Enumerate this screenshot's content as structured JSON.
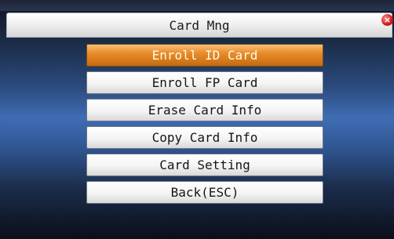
{
  "window": {
    "title": "Card Mng"
  },
  "menu": {
    "items": [
      {
        "label": "Enroll ID Card",
        "selected": true
      },
      {
        "label": "Enroll FP Card",
        "selected": false
      },
      {
        "label": "Erase Card Info",
        "selected": false
      },
      {
        "label": "Copy Card Info",
        "selected": false
      },
      {
        "label": "Card Setting",
        "selected": false
      },
      {
        "label": "Back(ESC)",
        "selected": false
      }
    ]
  },
  "icons": {
    "close": "close-icon"
  },
  "colors": {
    "selected_item": "#e98c2a",
    "background_accent": "#3f6db4"
  }
}
